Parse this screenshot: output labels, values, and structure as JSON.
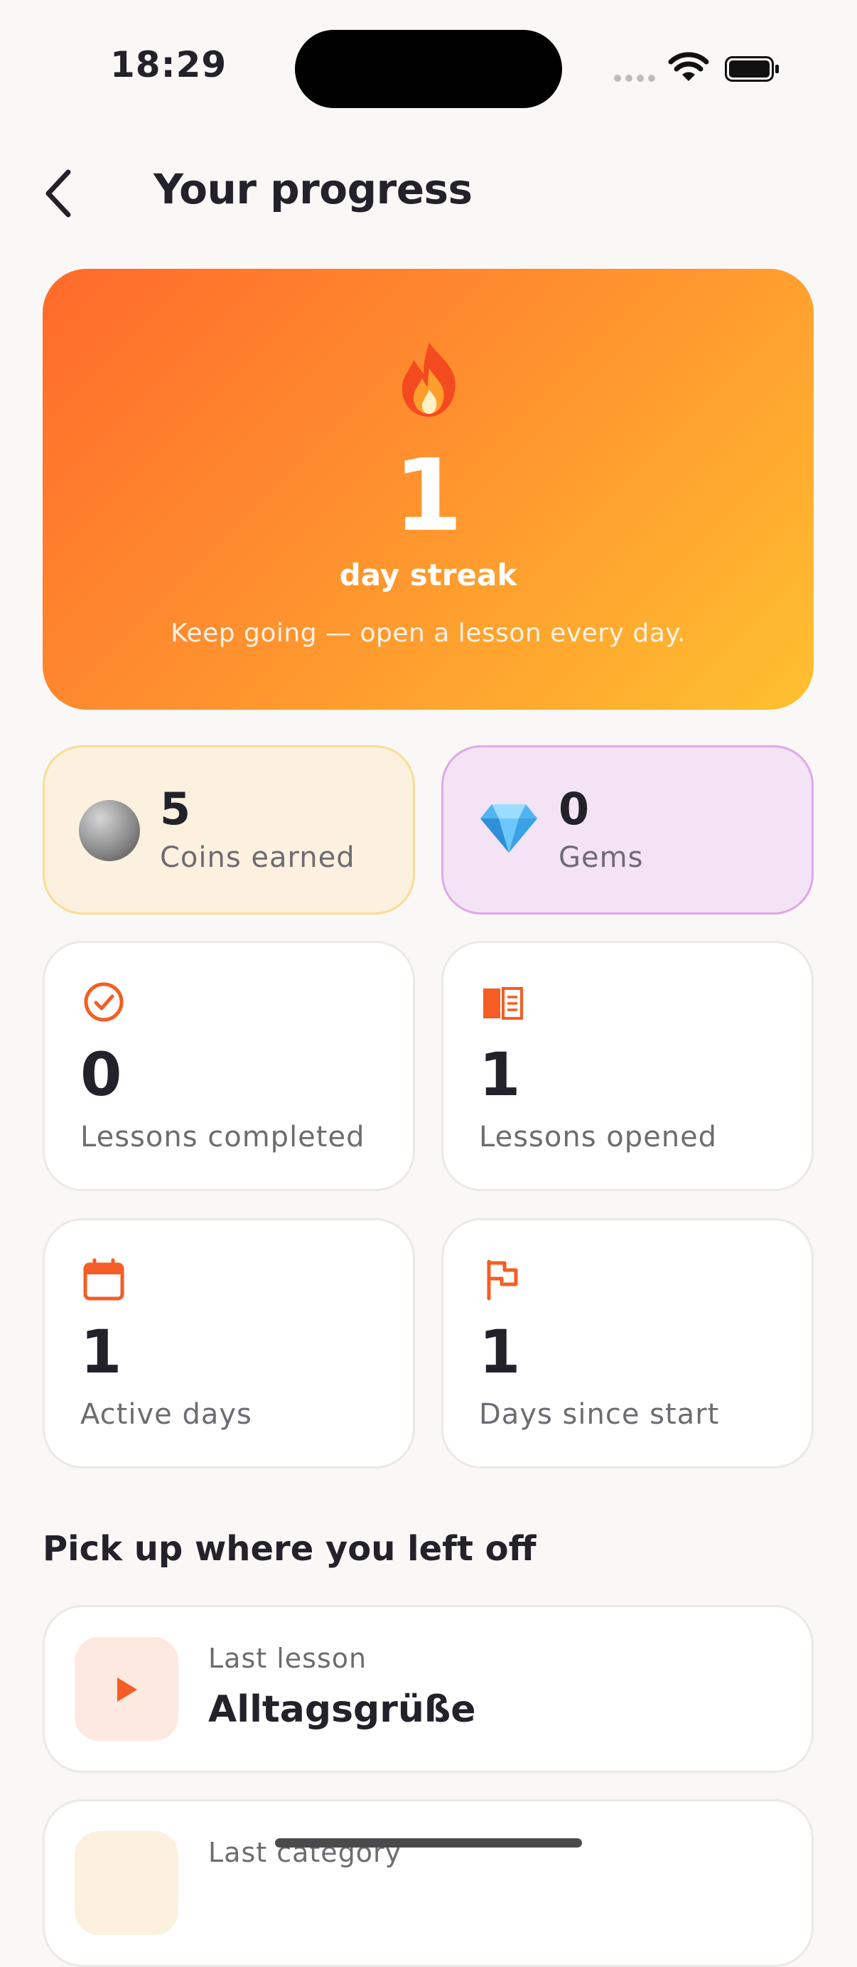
{
  "status_bar": {
    "time": "18:29"
  },
  "header": {
    "title": "Your progress"
  },
  "streak": {
    "value": "1",
    "label": "day streak",
    "subtitle": "Keep going — open a lesson every day."
  },
  "rewards": [
    {
      "value": "5",
      "label": "Coins earned",
      "icon": "coin-icon"
    },
    {
      "value": "0",
      "label": "Gems",
      "icon": "gem-icon"
    }
  ],
  "stats": [
    {
      "value": "0",
      "label": "Lessons completed",
      "icon": "check-circle-icon"
    },
    {
      "value": "1",
      "label": "Lessons opened",
      "icon": "open-book-icon"
    },
    {
      "value": "1",
      "label": "Active days",
      "icon": "calendar-icon"
    },
    {
      "value": "1",
      "label": "Days since start",
      "icon": "flag-icon"
    }
  ],
  "resume": {
    "heading": "Pick up where you left off",
    "last_lesson": {
      "label": "Last lesson",
      "value": "Alltagsgrüße",
      "icon": "play-icon"
    },
    "last_category": {
      "label": "Last category"
    }
  },
  "colors": {
    "accent": "#f45d25",
    "gradient_start": "#ff6a2b",
    "gradient_end": "#ffc030"
  }
}
